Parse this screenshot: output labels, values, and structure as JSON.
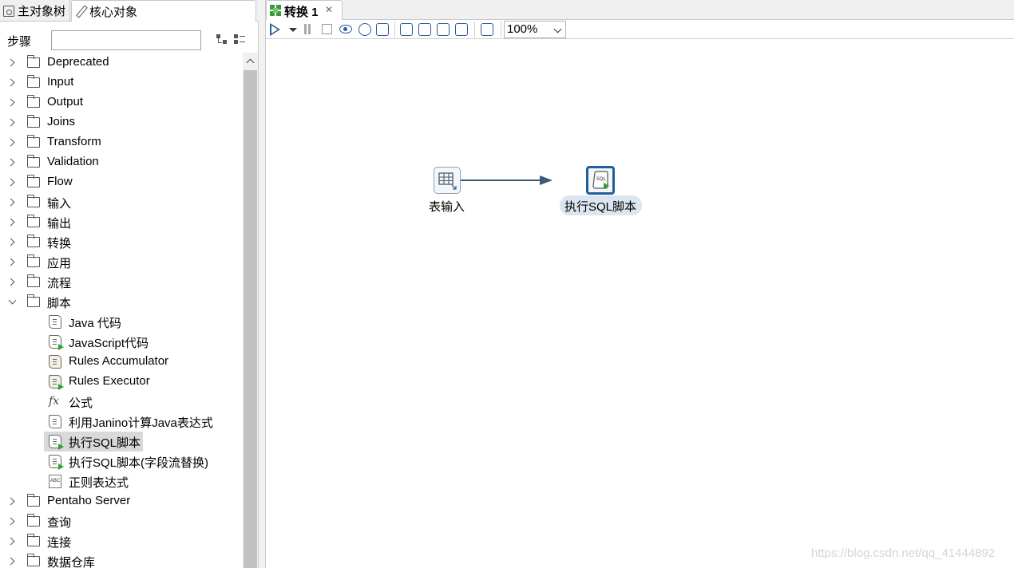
{
  "left_panel": {
    "tabs": [
      {
        "label": "主对象树",
        "icon": "document-icon"
      },
      {
        "label": "核心对象",
        "icon": "pencil-icon"
      }
    ],
    "steps_label": "步骤",
    "search": {
      "value": "",
      "placeholder": ""
    },
    "tree": [
      {
        "label": "Deprecated",
        "type": "folder",
        "expanded": false
      },
      {
        "label": "Input",
        "type": "folder",
        "expanded": false
      },
      {
        "label": "Output",
        "type": "folder",
        "expanded": false
      },
      {
        "label": "Joins",
        "type": "folder",
        "expanded": false
      },
      {
        "label": "Transform",
        "type": "folder",
        "expanded": false
      },
      {
        "label": "Validation",
        "type": "folder",
        "expanded": false
      },
      {
        "label": "Flow",
        "type": "folder",
        "expanded": false
      },
      {
        "label": "输入",
        "type": "folder",
        "expanded": false
      },
      {
        "label": "输出",
        "type": "folder",
        "expanded": false
      },
      {
        "label": "转换",
        "type": "folder",
        "expanded": false
      },
      {
        "label": "应用",
        "type": "folder",
        "expanded": false
      },
      {
        "label": "流程",
        "type": "folder",
        "expanded": false
      },
      {
        "label": "脚本",
        "type": "folder",
        "expanded": true
      },
      {
        "label": "Java 代码",
        "type": "leaf",
        "icon": "scroll-icon"
      },
      {
        "label": "JavaScript代码",
        "type": "leaf",
        "icon": "script-run-icon"
      },
      {
        "label": "Rules Accumulator",
        "type": "leaf",
        "icon": "rules-scroll-icon"
      },
      {
        "label": "Rules Executor",
        "type": "leaf",
        "icon": "rules-run-icon"
      },
      {
        "label": "公式",
        "type": "leaf",
        "icon": "formula-icon"
      },
      {
        "label": "利用Janino计算Java表达式",
        "type": "leaf",
        "icon": "scroll-icon"
      },
      {
        "label": "执行SQL脚本",
        "type": "leaf",
        "icon": "sql-run-icon",
        "selected": true
      },
      {
        "label": "执行SQL脚本(字段流替换)",
        "type": "leaf",
        "icon": "sql-field-icon"
      },
      {
        "label": "正则表达式",
        "type": "leaf",
        "icon": "regex-icon"
      },
      {
        "label": "Pentaho Server",
        "type": "folder",
        "expanded": false
      },
      {
        "label": "查询",
        "type": "folder",
        "expanded": false
      },
      {
        "label": "连接",
        "type": "folder",
        "expanded": false
      },
      {
        "label": "数据仓库",
        "type": "folder",
        "expanded": false
      }
    ]
  },
  "editor": {
    "tab": {
      "label": "转换 1",
      "icon": "transformation-icon"
    },
    "zoom": "100%",
    "nodes": [
      {
        "label": "表输入",
        "icon": "table-input-icon"
      },
      {
        "label": "执行SQL脚本",
        "icon": "sql-script-icon",
        "selected": true
      }
    ]
  },
  "watermark": "https://blog.csdn.net/qq_41444892",
  "colors": {
    "accent": "#1f5f9a",
    "run_green": "#2aa52a",
    "hop": "#3d5a7a"
  }
}
